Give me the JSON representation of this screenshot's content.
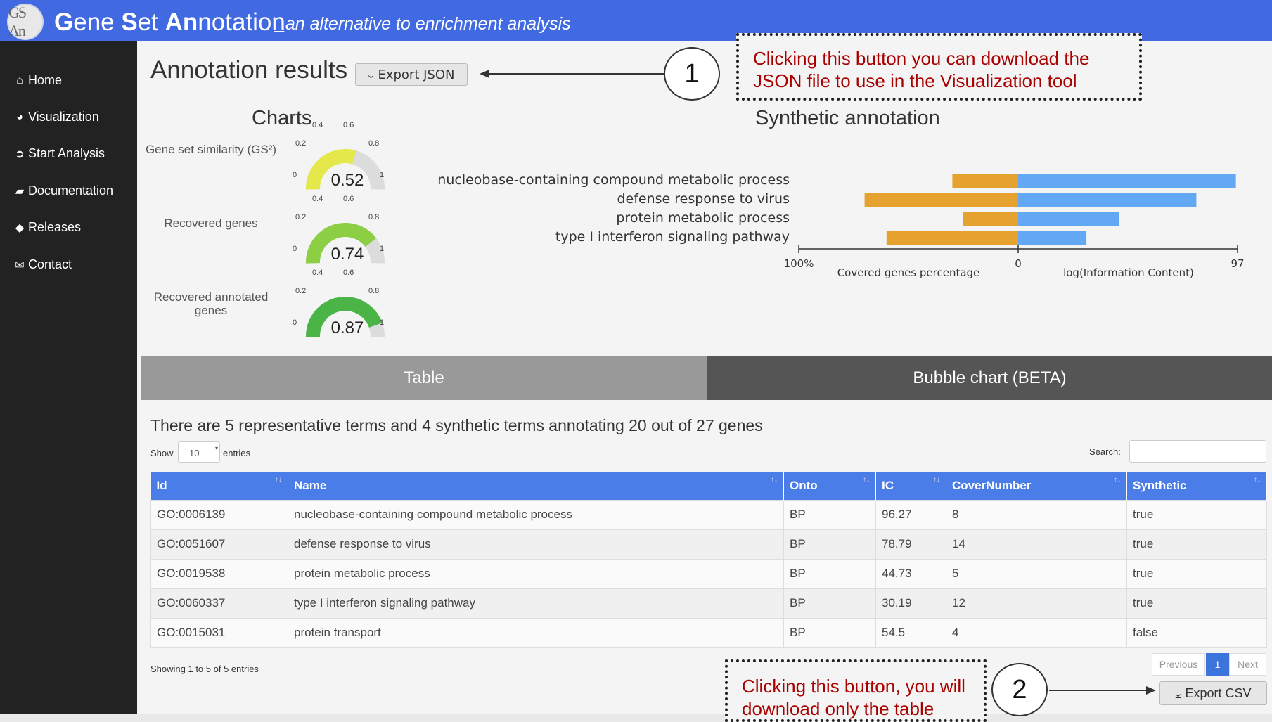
{
  "header": {
    "logo_text": "GS An",
    "title_parts": [
      "G",
      "ene ",
      "S",
      "et ",
      "An",
      "notation"
    ],
    "subtitle": "_an alternative to enrichment analysis",
    "colors": {
      "bar": "#4169e1",
      "sidebar": "#222222"
    }
  },
  "sidebar": {
    "items": [
      {
        "icon": "home-icon",
        "label": "Home"
      },
      {
        "icon": "pie-chart-icon",
        "label": "Visualization"
      },
      {
        "icon": "play-circle-icon",
        "label": "Start Analysis"
      },
      {
        "icon": "book-icon",
        "label": "Documentation"
      },
      {
        "icon": "tag-icon",
        "label": "Releases"
      },
      {
        "icon": "envelope-icon",
        "label": "Contact"
      }
    ]
  },
  "main": {
    "title": "Annotation results",
    "export_json_label": "Export JSON",
    "callout_1": {
      "number": "1",
      "line1": "Clicking this button you can download the",
      "line2": "JSON file to use in the Visualization tool"
    },
    "callout_2": {
      "number": "2",
      "line1": "Clicking this button, you will",
      "line2": "download only the table"
    },
    "charts_title": "Charts",
    "synthetic_title": "Synthetic annotation",
    "gauges": [
      {
        "label": "Gene set similarity (GS²)",
        "value": 0.52,
        "value_text": "0.52",
        "color": "#e5e84a"
      },
      {
        "label": "Recovered genes",
        "value": 0.74,
        "value_text": "0.74",
        "color": "#8ccf45"
      },
      {
        "label": "Recovered annotated genes",
        "value": 0.87,
        "value_text": "0.87",
        "color": "#4bb446"
      }
    ],
    "gauge_ticks": [
      "0",
      "0.2",
      "0.4",
      "0.6",
      "0.8",
      "1"
    ],
    "tabs": {
      "table": "Table",
      "bubble": "Bubble chart (BETA)"
    },
    "summary": "There are 5 representative terms and 4 synthetic terms annotating 20 out of 27 genes",
    "show_label": "Show",
    "show_value": "10",
    "entries_label": "entries",
    "search_label": "Search:",
    "showing_text": "Showing 1 to 5 of 5 entries",
    "pager": {
      "previous": "Previous",
      "page": "1",
      "next": "Next"
    },
    "export_csv_label": "Export CSV"
  },
  "table": {
    "columns": [
      "Id",
      "Name",
      "Onto",
      "IC",
      "CoverNumber",
      "Synthetic"
    ],
    "rows": [
      [
        "GO:0006139",
        "nucleobase-containing compound metabolic process",
        "BP",
        "96.27",
        "8",
        "true"
      ],
      [
        "GO:0051607",
        "defense response to virus",
        "BP",
        "78.79",
        "14",
        "true"
      ],
      [
        "GO:0019538",
        "protein metabolic process",
        "BP",
        "44.73",
        "5",
        "true"
      ],
      [
        "GO:0060337",
        "type I interferon signaling pathway",
        "BP",
        "30.19",
        "12",
        "true"
      ],
      [
        "GO:0015031",
        "protein transport",
        "BP",
        "54.5",
        "4",
        "false"
      ]
    ]
  },
  "chart_data": {
    "type": "bar",
    "categories": [
      "nucleobase-containing compound metabolic process",
      "defense response to virus",
      "protein metabolic process",
      "type I interferon signaling pathway"
    ],
    "series": [
      {
        "values": [
          30,
          70,
          25,
          60
        ],
        "color": "#e5a22f"
      },
      {
        "values": [
          96.27,
          78.79,
          44.73,
          30.19
        ],
        "color": "#62a8f2"
      }
    ],
    "xlabel_left": "Covered genes percentage",
    "xlabel_right": "log(Information Content)",
    "ticks": [
      "100%",
      "0",
      "97"
    ],
    "left_range": [
      0,
      100
    ],
    "right_range": [
      0,
      97
    ]
  }
}
